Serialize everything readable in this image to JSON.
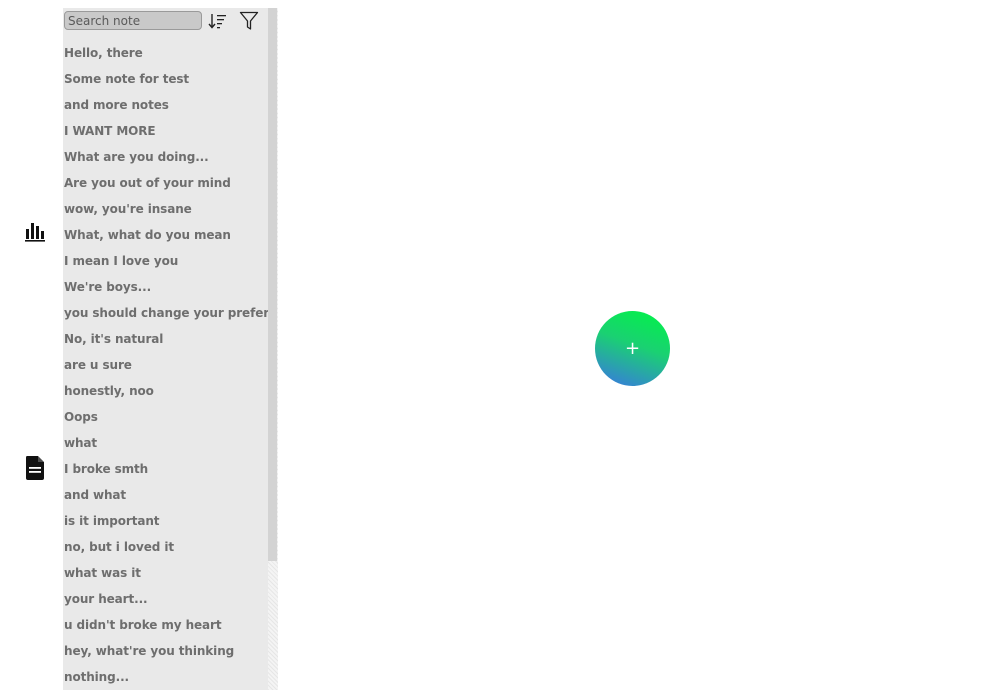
{
  "search": {
    "placeholder": "Search note"
  },
  "toolbar": {
    "sort_icon": "sort-descending-icon",
    "filter_icon": "filter-icon"
  },
  "rail": {
    "stats_icon": "bar-chart-icon",
    "notes_icon": "note-file-icon"
  },
  "notes": [
    "Hello, there",
    "Some note for test",
    "and more notes",
    "I WANT MORE",
    "What are you doing...",
    "Are you out of your mind",
    "wow, you're insane",
    "What, what do you mean",
    "I mean I love you",
    "We're boys...",
    "you should change your preferences",
    "No, it's natural",
    "are u sure",
    "honestly, noo",
    "Oops",
    "what",
    "I broke smth",
    "and what",
    "is it important",
    "no, but i loved it",
    "what was it",
    "your heart...",
    "u didn't broke my heart",
    "hey, what're you thinking",
    "nothing..."
  ],
  "fab": {
    "label": "+"
  },
  "colors": {
    "panel_bg": "#e9e9e9",
    "note_text": "#6e6e6e",
    "fab_gradient_start": "#00f545",
    "fab_gradient_end": "#3a74e6"
  }
}
